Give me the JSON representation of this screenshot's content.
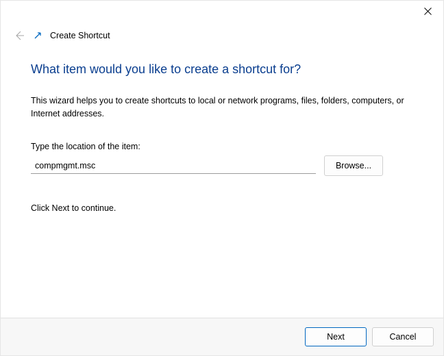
{
  "window": {
    "title": "Create Shortcut"
  },
  "page": {
    "heading": "What item would you like to create a shortcut for?",
    "description": "This wizard helps you to create shortcuts to local or network programs, files, folders, computers, or Internet addresses.",
    "field_label": "Type the location of the item:",
    "location_value": "compmgmt.msc",
    "browse_label": "Browse...",
    "continue_hint": "Click Next to continue."
  },
  "footer": {
    "next_label": "Next",
    "cancel_label": "Cancel"
  }
}
